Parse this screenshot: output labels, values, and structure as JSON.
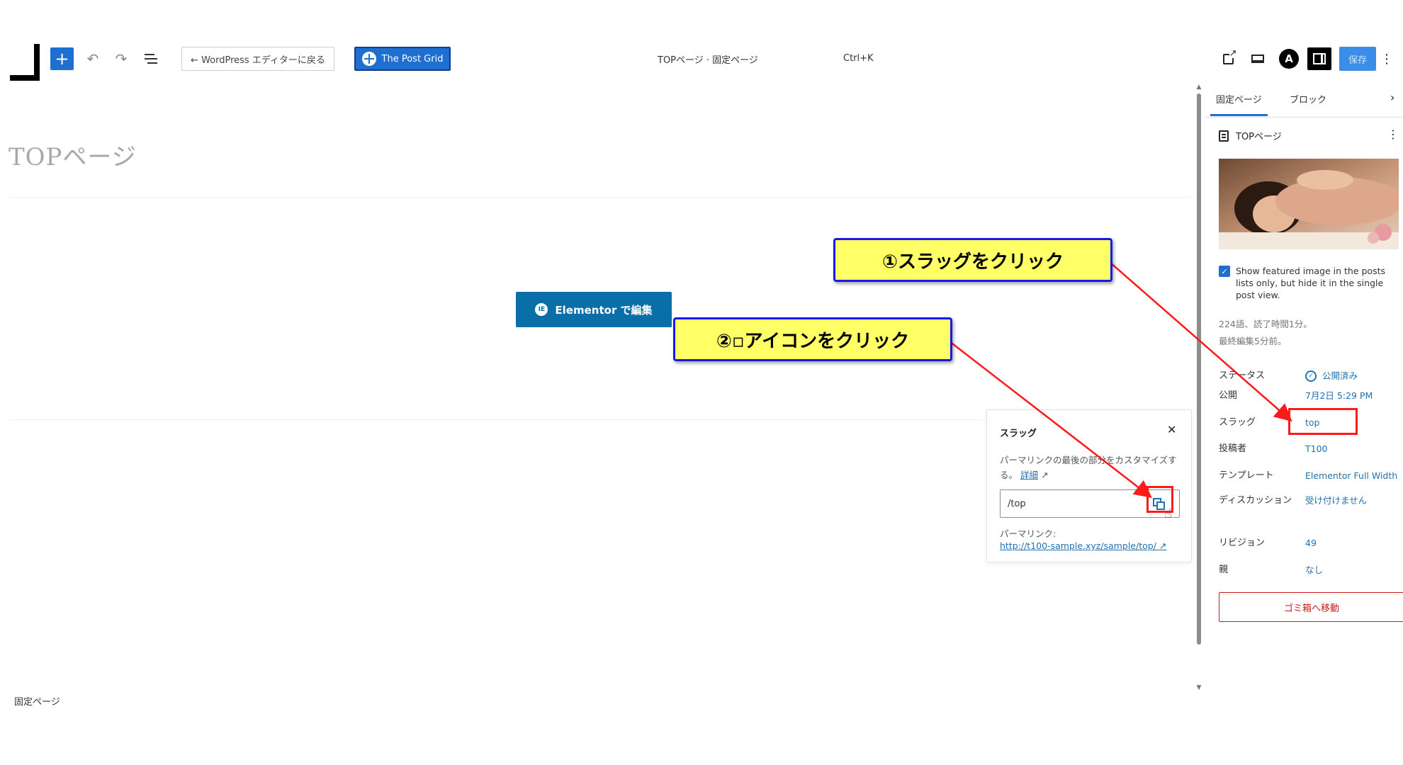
{
  "toolbar": {
    "back_to_wp": "← WordPress エディターに戻る",
    "post_grid": "The Post Grid",
    "document_title": "TOPページ · 固定ページ",
    "shortcut": "Ctrl+K",
    "save": "保存"
  },
  "editor": {
    "page_title": "TOPページ",
    "elementor_button": "Elementor で編集",
    "footer_breadcrumb": "固定ページ"
  },
  "sidebar": {
    "tabs": [
      "固定ページ",
      "ブロック"
    ],
    "document_name": "TOPページ",
    "featured_option": "Show featured image in the posts lists only, but hide it in the single post view.",
    "word_count": "224語、読了時間1分。",
    "last_edited": "最終編集5分前。",
    "properties": [
      {
        "label": "ステータス",
        "value": "公開済み"
      },
      {
        "label": "公開",
        "value": "7月2日 5:29 PM"
      },
      {
        "label": "スラッグ",
        "value": "top"
      },
      {
        "label": "投稿者",
        "value": "T100"
      },
      {
        "label": "テンプレート",
        "value": "Elementor Full Width"
      },
      {
        "label": "ディスカッション",
        "value": "受け付けません"
      },
      {
        "label": "リビジョン",
        "value": "49"
      },
      {
        "label": "親",
        "value": "なし"
      }
    ],
    "trash": "ゴミ箱へ移動"
  },
  "slug_popover": {
    "title": "スラッグ",
    "description": "パーマリンクの最後の部分をカスタマイズする。",
    "details_link": "詳細",
    "slug_value": "/top",
    "permalink_label": "パーマリンク:",
    "permalink_url": "http://t100-sample.xyz/sample/top/"
  },
  "annotations": {
    "callout_1": "①スラッグをクリック",
    "callout_2": "②▫アイコンをクリック"
  },
  "colors": {
    "accent_blue": "#1e6fd0",
    "link_blue": "#2271b1",
    "callout_fill": "#ffff66",
    "callout_border": "#1a1ae6",
    "annotation_red": "#ff1a1a"
  }
}
